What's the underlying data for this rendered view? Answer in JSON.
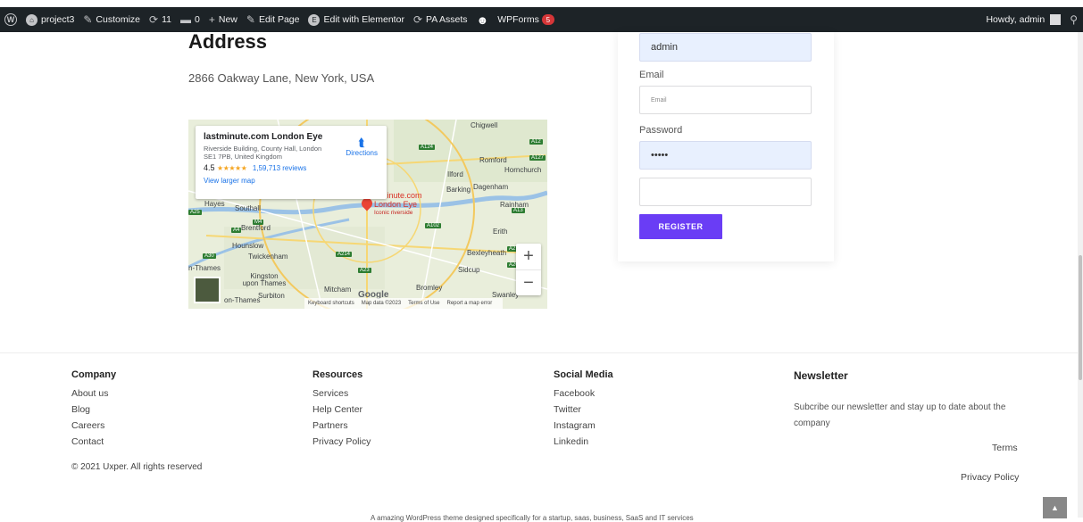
{
  "admin_bar": {
    "site_name": "project3",
    "customize": "Customize",
    "updates_count": "11",
    "comments_count": "0",
    "new": "New",
    "edit_page": "Edit Page",
    "edit_elementor": "Edit with Elementor",
    "pa_assets": "PA Assets",
    "wpforms": "WPForms",
    "wpforms_badge": "5",
    "howdy": "Howdy, admin"
  },
  "address": {
    "heading": "Address",
    "text": "2866 Oakway Lane, New York, USA"
  },
  "map": {
    "place_name": "lastminute.com London Eye",
    "place_address": "Riverside Building, County Hall, London SE1 7PB, United Kingdom",
    "rating": "4.5",
    "stars": "★★★★★",
    "reviews": "1,59,713 reviews",
    "larger_map": "View larger map",
    "directions": "Directions",
    "pin_label": "stminute.com London Eye",
    "pin_sub": "Iconic riverside",
    "zoom_in": "+",
    "zoom_out": "−",
    "google": "Google",
    "footer": {
      "shortcuts": "Keyboard shortcuts",
      "map_data": "Map data ©2023",
      "terms": "Terms of Use",
      "report": "Report a map error"
    },
    "towns": {
      "chigwell": "Chigwell",
      "romford": "Romford",
      "hornchurch": "Hornchurch",
      "ilford": "Ilford",
      "barking": "Barking",
      "dagenham": "Dagenham",
      "rainham": "Rainham",
      "hayes": "Hayes",
      "southall": "Southall",
      "brentford": "Brentford",
      "erith": "Erith",
      "bexleyheath": "Bexleyheath",
      "hounslow": "Hounslow",
      "twickenham": "Twickenham",
      "sidcup": "Sidcup",
      "thames": "n-Thames",
      "kingston": "Kingston upon Thames",
      "surbiton": "Surbiton",
      "mitcham": "Mitcham",
      "bromley": "Bromley",
      "swanley": "Swanley",
      "on_thames": "on-Thames"
    },
    "roads": {
      "a12": "A12",
      "a127": "A127",
      "a124": "A124",
      "m4": "M4",
      "a4": "A4",
      "a102": "A102",
      "a13": "A13",
      "a214": "A214",
      "a20": "A20",
      "a23": "A23",
      "a30": "A30",
      "a2": "A2",
      "a25": "A25"
    }
  },
  "form": {
    "username_value": "admin",
    "email_label": "Email",
    "email_placeholder": "Email",
    "password_label": "Password",
    "password_value": "•••••",
    "extra_value": "",
    "register_label": "REGISTER"
  },
  "footer": {
    "company": {
      "title": "Company",
      "links": [
        "About us",
        "Blog",
        "Careers",
        "Contact"
      ]
    },
    "resources": {
      "title": "Resources",
      "links": [
        "Services",
        "Help Center",
        "Partners",
        "Privacy Policy"
      ]
    },
    "social": {
      "title": "Social Media",
      "links": [
        "Facebook",
        "Twitter",
        "Instagram",
        "Linkedin"
      ]
    },
    "newsletter": {
      "title": "Newsletter",
      "text": "Subcribe our newsletter and stay up to date about the company"
    },
    "terms": "Terms",
    "privacy": "Privacy Policy",
    "copyright": "© 2021 Uxper. All rights reserved",
    "bottom_note": "A amazing WordPress theme designed specifically for a startup, saas, business, SaaS and IT services",
    "to_top": "▲"
  }
}
